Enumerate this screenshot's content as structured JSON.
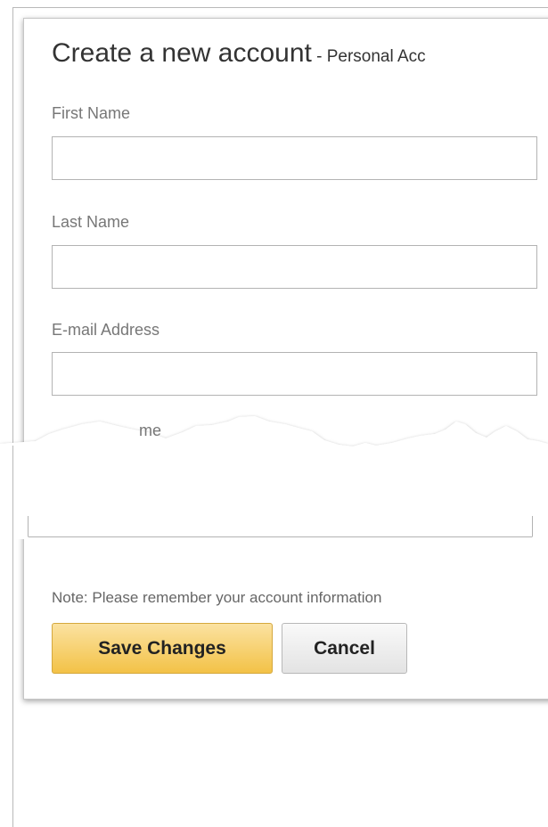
{
  "form": {
    "title": "Create a new account",
    "subtitle": " - Personal Acc",
    "fields": [
      {
        "label": "First Name",
        "value": ""
      },
      {
        "label": "Last Name",
        "value": ""
      },
      {
        "label": "E-mail Address",
        "value": ""
      },
      {
        "label": "me",
        "value": ""
      }
    ],
    "note": "Note: Please remember your account information",
    "buttons": {
      "save": "Save Changes",
      "cancel": "Cancel"
    }
  },
  "colors": {
    "save_button": "#f3c247",
    "cancel_button": "#e3e3e3",
    "label_text": "#777777"
  }
}
